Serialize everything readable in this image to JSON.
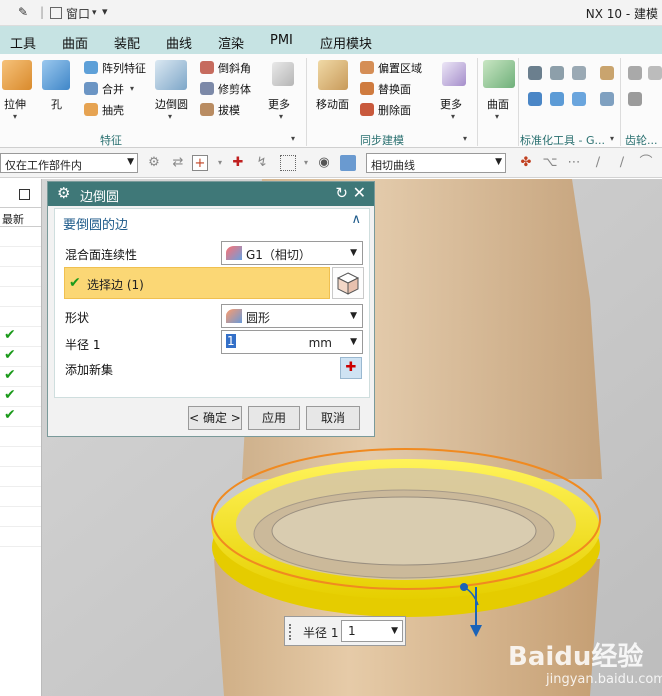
{
  "titlebar": {
    "window_menu": "窗口",
    "title": "NX 10 - 建模"
  },
  "menu": [
    "工具",
    "曲面",
    "装配",
    "曲线",
    "渲染",
    "PMI",
    "应用模块"
  ],
  "ribbon": {
    "extrude": "拉伸",
    "hole": "孔",
    "pattern_feature": "阵列特征",
    "unite": "合并",
    "shell": "抽壳",
    "edge_blend": "边倒圆",
    "chamfer": "倒斜角",
    "trim_body": "修剪体",
    "draft": "拔模",
    "more1": "更多",
    "move_face": "移动面",
    "offset_region": "偏置区域",
    "replace_face": "替换面",
    "delete_face": "删除面",
    "more2": "更多",
    "surface": "曲面",
    "group_feature": "特征",
    "group_sync": "同步建模",
    "group_std": "标准化工具 - G...",
    "group_gear": "齿轮..."
  },
  "toolbar2": {
    "scope_filter": "仅在工作部件内",
    "curve_rule": "相切曲线"
  },
  "left_panel": {
    "header": "最新",
    "checked_rows": 5
  },
  "dialog": {
    "title": "边倒圆",
    "section_title": "要倒圆的边",
    "continuity_label": "混合面连续性",
    "continuity_value": "G1（相切）",
    "select_edge_label": "选择边 (1)",
    "shape_label": "形状",
    "shape_value": "圆形",
    "radius_label": "半径 1",
    "radius_value": "1",
    "radius_unit": "mm",
    "add_new_set_label": "添加新集",
    "ok_button": "< 确定 >",
    "apply_button": "应用",
    "cancel_button": "取消"
  },
  "radius_tip": {
    "label": "半径 1",
    "value": "1"
  },
  "watermark": {
    "brand": "Baidu经验",
    "url": "jingyan.baidu.com"
  },
  "colors": {
    "menubar": "#c6e3e3",
    "dialog_title": "#3f7878",
    "selection_highlight": "#fbd775",
    "fillet_yellow": "#f7e600",
    "model_tan": "#d9b993"
  }
}
